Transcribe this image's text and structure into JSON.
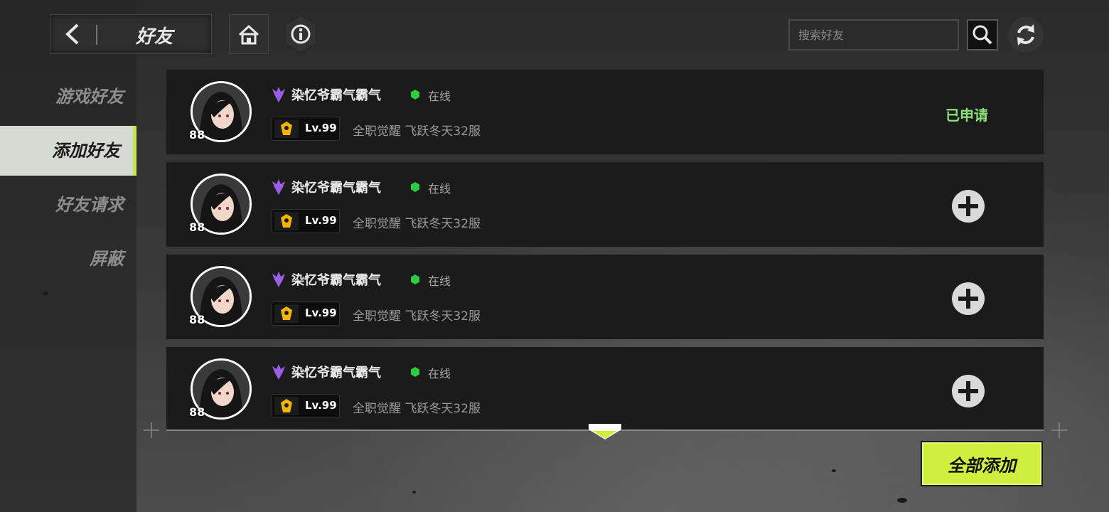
{
  "header": {
    "title": "好友",
    "search_placeholder": "搜索好友"
  },
  "sidebar": {
    "items": [
      {
        "label": "游戏好友",
        "active": false
      },
      {
        "label": "添加好友",
        "active": true
      },
      {
        "label": "好友请求",
        "active": false
      },
      {
        "label": "屏蔽",
        "active": false
      }
    ]
  },
  "friends": [
    {
      "avatar_level": "88",
      "name": "染忆爷霸气霸气",
      "status": "在线",
      "level": "Lv.99",
      "server": "全职觉醒 飞跃冬天32服",
      "action": "已申请"
    },
    {
      "avatar_level": "88",
      "name": "染忆爷霸气霸气",
      "status": "在线",
      "level": "Lv.99",
      "server": "全职觉醒 飞跃冬天32服",
      "action": "add"
    },
    {
      "avatar_level": "88",
      "name": "染忆爷霸气霸气",
      "status": "在线",
      "level": "Lv.99",
      "server": "全职觉醒 飞跃冬天32服",
      "action": "add"
    },
    {
      "avatar_level": "88",
      "name": "染忆爷霸气霸气",
      "status": "在线",
      "level": "Lv.99",
      "server": "全职觉醒 飞跃冬天32服",
      "action": "add"
    }
  ],
  "footer": {
    "add_all_label": "全部添加"
  },
  "colors": {
    "accent": "#cfef3e",
    "applied": "#8ee07a",
    "online": "#2ecc40",
    "rank_purple": "#9b5de5",
    "level_gold": "#f5b400"
  }
}
